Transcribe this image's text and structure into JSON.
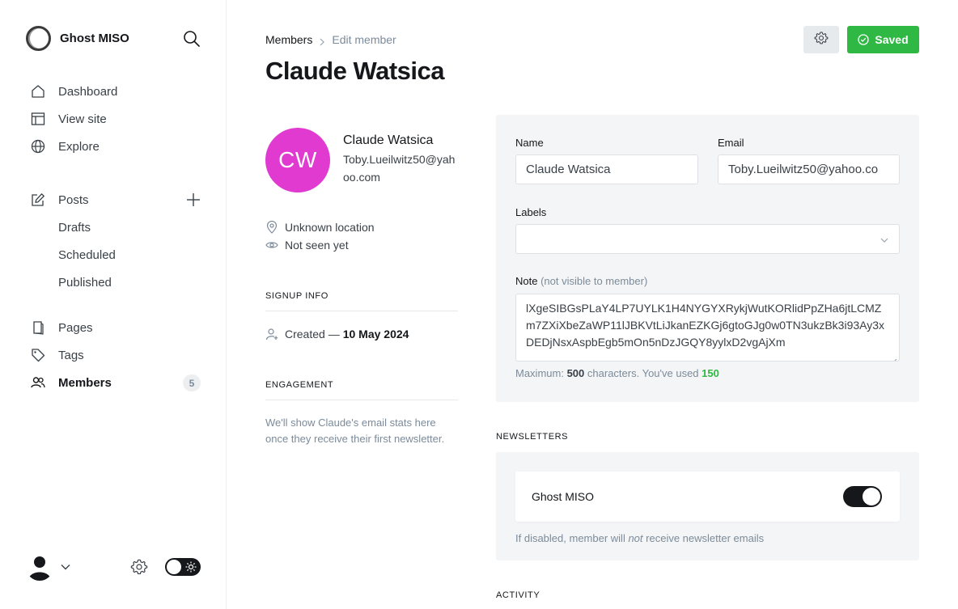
{
  "sidebar": {
    "brand": "Ghost MISO",
    "nav_primary": [
      {
        "label": "Dashboard",
        "icon": "home-icon"
      },
      {
        "label": "View site",
        "icon": "layout-icon"
      },
      {
        "label": "Explore",
        "icon": "globe-icon"
      }
    ],
    "posts": {
      "label": "Posts",
      "icon": "edit-icon"
    },
    "post_sub": [
      {
        "label": "Drafts"
      },
      {
        "label": "Scheduled"
      },
      {
        "label": "Published"
      }
    ],
    "pages": {
      "label": "Pages",
      "icon": "pages-icon"
    },
    "tags": {
      "label": "Tags",
      "icon": "tag-icon"
    },
    "members": {
      "label": "Members",
      "icon": "members-icon",
      "count": "5"
    }
  },
  "header": {
    "breadcrumb_parent": "Members",
    "breadcrumb_current": "Edit member",
    "title": "Claude Watsica",
    "saved_label": "Saved"
  },
  "profile": {
    "initials": "CW",
    "name": "Claude Watsica",
    "email": "Toby.Lueilwitz50@yahoo.com",
    "location": "Unknown location",
    "seen": "Not seen yet",
    "avatar_color": "#e03ad0"
  },
  "signup": {
    "heading": "SIGNUP INFO",
    "created_label": "Created —",
    "created_date": "10 May 2024"
  },
  "engagement": {
    "heading": "ENGAGEMENT",
    "text": "We'll show Claude's email stats here once they receive their first newsletter."
  },
  "form": {
    "name_label": "Name",
    "name_value": "Claude Watsica",
    "email_label": "Email",
    "email_value": "Toby.Lueilwitz50@yahoo.co",
    "labels_label": "Labels",
    "note_label": "Note",
    "note_hint": "(not visible to member)",
    "note_value": "lXgeSIBGsPLaY4LP7UYLK1H4NYGYXRykjWutKORlidPpZHa6jtLCMZm7ZXiXbeZaWP11lJBKVtLiJkanEZKGj6gtoGJg0w0TN3ukzBk3i93Ay3xDEDjNsxAspbEgb5mOn5nDzJGQY8yylxD2vgAjXm",
    "counter_prefix": "Maximum:",
    "counter_max": "500",
    "counter_mid": "characters. You've used",
    "counter_used": "150"
  },
  "newsletters": {
    "heading": "NEWSLETTERS",
    "name": "Ghost MISO",
    "subscribed": true,
    "help_prefix": "If disabled, member will",
    "help_em": "not",
    "help_suffix": "receive newsletter emails"
  },
  "activity": {
    "heading": "ACTIVITY"
  },
  "colors": {
    "accent_green": "#2fb843",
    "dark": "#15171a"
  }
}
